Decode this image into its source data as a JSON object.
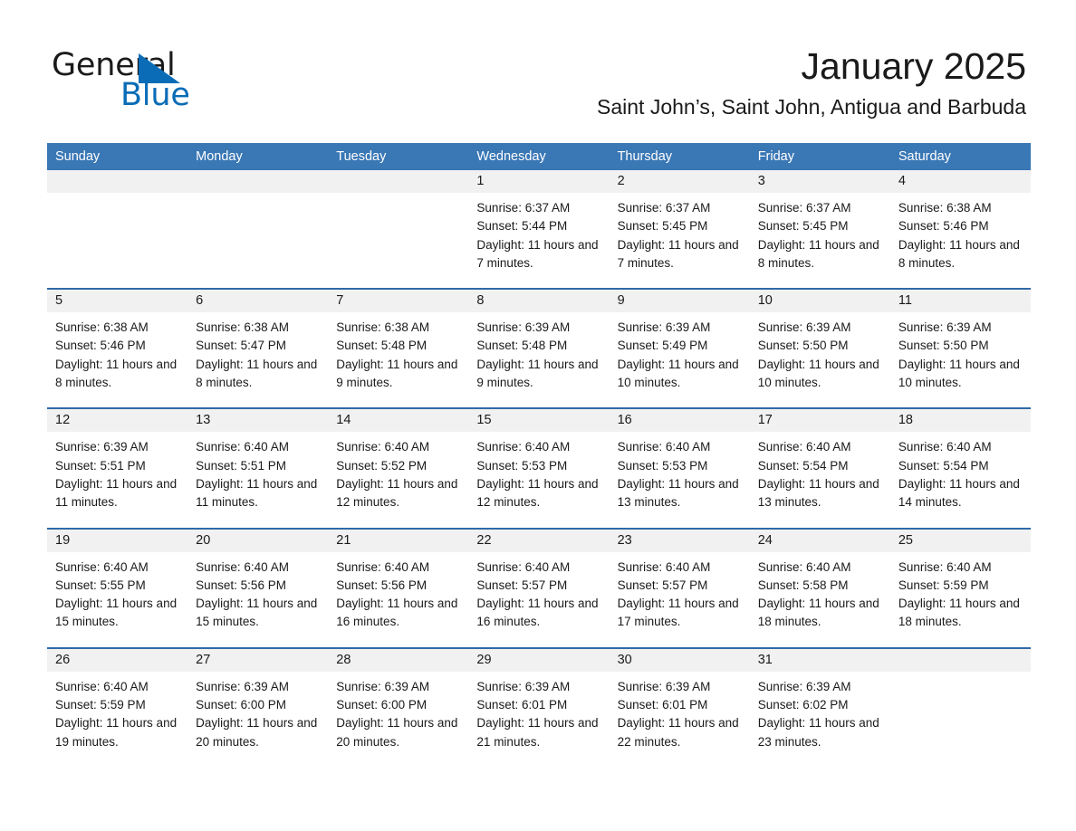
{
  "brand": {
    "name_part1": "General",
    "name_part2": "Blue",
    "triangle_icon": "triangle-icon",
    "accent_color": "#0a6cb6"
  },
  "header": {
    "month_title": "January 2025",
    "location": "Saint John’s, Saint John, Antigua and Barbuda"
  },
  "calendar": {
    "header_bg": "#3a77b5",
    "header_text_color": "#ffffff",
    "row_divider_color": "#2f6aa8",
    "daynum_bg": "#f1f1f1",
    "weekdays": [
      "Sunday",
      "Monday",
      "Tuesday",
      "Wednesday",
      "Thursday",
      "Friday",
      "Saturday"
    ],
    "weeks": [
      [
        {
          "day": "",
          "sunrise": "",
          "sunset": "",
          "daylight": ""
        },
        {
          "day": "",
          "sunrise": "",
          "sunset": "",
          "daylight": ""
        },
        {
          "day": "",
          "sunrise": "",
          "sunset": "",
          "daylight": ""
        },
        {
          "day": "1",
          "sunrise": "Sunrise: 6:37 AM",
          "sunset": "Sunset: 5:44 PM",
          "daylight": "Daylight: 11 hours and 7 minutes."
        },
        {
          "day": "2",
          "sunrise": "Sunrise: 6:37 AM",
          "sunset": "Sunset: 5:45 PM",
          "daylight": "Daylight: 11 hours and 7 minutes."
        },
        {
          "day": "3",
          "sunrise": "Sunrise: 6:37 AM",
          "sunset": "Sunset: 5:45 PM",
          "daylight": "Daylight: 11 hours and 8 minutes."
        },
        {
          "day": "4",
          "sunrise": "Sunrise: 6:38 AM",
          "sunset": "Sunset: 5:46 PM",
          "daylight": "Daylight: 11 hours and 8 minutes."
        }
      ],
      [
        {
          "day": "5",
          "sunrise": "Sunrise: 6:38 AM",
          "sunset": "Sunset: 5:46 PM",
          "daylight": "Daylight: 11 hours and 8 minutes."
        },
        {
          "day": "6",
          "sunrise": "Sunrise: 6:38 AM",
          "sunset": "Sunset: 5:47 PM",
          "daylight": "Daylight: 11 hours and 8 minutes."
        },
        {
          "day": "7",
          "sunrise": "Sunrise: 6:38 AM",
          "sunset": "Sunset: 5:48 PM",
          "daylight": "Daylight: 11 hours and 9 minutes."
        },
        {
          "day": "8",
          "sunrise": "Sunrise: 6:39 AM",
          "sunset": "Sunset: 5:48 PM",
          "daylight": "Daylight: 11 hours and 9 minutes."
        },
        {
          "day": "9",
          "sunrise": "Sunrise: 6:39 AM",
          "sunset": "Sunset: 5:49 PM",
          "daylight": "Daylight: 11 hours and 10 minutes."
        },
        {
          "day": "10",
          "sunrise": "Sunrise: 6:39 AM",
          "sunset": "Sunset: 5:50 PM",
          "daylight": "Daylight: 11 hours and 10 minutes."
        },
        {
          "day": "11",
          "sunrise": "Sunrise: 6:39 AM",
          "sunset": "Sunset: 5:50 PM",
          "daylight": "Daylight: 11 hours and 10 minutes."
        }
      ],
      [
        {
          "day": "12",
          "sunrise": "Sunrise: 6:39 AM",
          "sunset": "Sunset: 5:51 PM",
          "daylight": "Daylight: 11 hours and 11 minutes."
        },
        {
          "day": "13",
          "sunrise": "Sunrise: 6:40 AM",
          "sunset": "Sunset: 5:51 PM",
          "daylight": "Daylight: 11 hours and 11 minutes."
        },
        {
          "day": "14",
          "sunrise": "Sunrise: 6:40 AM",
          "sunset": "Sunset: 5:52 PM",
          "daylight": "Daylight: 11 hours and 12 minutes."
        },
        {
          "day": "15",
          "sunrise": "Sunrise: 6:40 AM",
          "sunset": "Sunset: 5:53 PM",
          "daylight": "Daylight: 11 hours and 12 minutes."
        },
        {
          "day": "16",
          "sunrise": "Sunrise: 6:40 AM",
          "sunset": "Sunset: 5:53 PM",
          "daylight": "Daylight: 11 hours and 13 minutes."
        },
        {
          "day": "17",
          "sunrise": "Sunrise: 6:40 AM",
          "sunset": "Sunset: 5:54 PM",
          "daylight": "Daylight: 11 hours and 13 minutes."
        },
        {
          "day": "18",
          "sunrise": "Sunrise: 6:40 AM",
          "sunset": "Sunset: 5:54 PM",
          "daylight": "Daylight: 11 hours and 14 minutes."
        }
      ],
      [
        {
          "day": "19",
          "sunrise": "Sunrise: 6:40 AM",
          "sunset": "Sunset: 5:55 PM",
          "daylight": "Daylight: 11 hours and 15 minutes."
        },
        {
          "day": "20",
          "sunrise": "Sunrise: 6:40 AM",
          "sunset": "Sunset: 5:56 PM",
          "daylight": "Daylight: 11 hours and 15 minutes."
        },
        {
          "day": "21",
          "sunrise": "Sunrise: 6:40 AM",
          "sunset": "Sunset: 5:56 PM",
          "daylight": "Daylight: 11 hours and 16 minutes."
        },
        {
          "day": "22",
          "sunrise": "Sunrise: 6:40 AM",
          "sunset": "Sunset: 5:57 PM",
          "daylight": "Daylight: 11 hours and 16 minutes."
        },
        {
          "day": "23",
          "sunrise": "Sunrise: 6:40 AM",
          "sunset": "Sunset: 5:57 PM",
          "daylight": "Daylight: 11 hours and 17 minutes."
        },
        {
          "day": "24",
          "sunrise": "Sunrise: 6:40 AM",
          "sunset": "Sunset: 5:58 PM",
          "daylight": "Daylight: 11 hours and 18 minutes."
        },
        {
          "day": "25",
          "sunrise": "Sunrise: 6:40 AM",
          "sunset": "Sunset: 5:59 PM",
          "daylight": "Daylight: 11 hours and 18 minutes."
        }
      ],
      [
        {
          "day": "26",
          "sunrise": "Sunrise: 6:40 AM",
          "sunset": "Sunset: 5:59 PM",
          "daylight": "Daylight: 11 hours and 19 minutes."
        },
        {
          "day": "27",
          "sunrise": "Sunrise: 6:39 AM",
          "sunset": "Sunset: 6:00 PM",
          "daylight": "Daylight: 11 hours and 20 minutes."
        },
        {
          "day": "28",
          "sunrise": "Sunrise: 6:39 AM",
          "sunset": "Sunset: 6:00 PM",
          "daylight": "Daylight: 11 hours and 20 minutes."
        },
        {
          "day": "29",
          "sunrise": "Sunrise: 6:39 AM",
          "sunset": "Sunset: 6:01 PM",
          "daylight": "Daylight: 11 hours and 21 minutes."
        },
        {
          "day": "30",
          "sunrise": "Sunrise: 6:39 AM",
          "sunset": "Sunset: 6:01 PM",
          "daylight": "Daylight: 11 hours and 22 minutes."
        },
        {
          "day": "31",
          "sunrise": "Sunrise: 6:39 AM",
          "sunset": "Sunset: 6:02 PM",
          "daylight": "Daylight: 11 hours and 23 minutes."
        },
        {
          "day": "",
          "sunrise": "",
          "sunset": "",
          "daylight": ""
        }
      ]
    ]
  }
}
